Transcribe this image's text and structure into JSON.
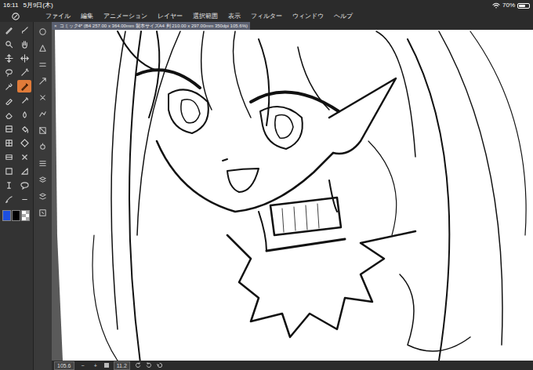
{
  "status_bar": {
    "time": "16:11",
    "date": "5月9日(木)",
    "battery": "70%"
  },
  "menu": [
    "ファイル",
    "編集",
    "アニメーション",
    "レイヤー",
    "選択範囲",
    "表示",
    "フィルター",
    "ウィンドウ",
    "ヘルプ"
  ],
  "document_tab": {
    "close": "×",
    "title": "コミック4* (B4 257.00 x 364.00mm 製本サイズA4 判 210.00 x 297.00mm 350dpi 105.6%)"
  },
  "tools": [
    {
      "selected": false
    },
    {
      "selected": false
    },
    {
      "selected": false
    },
    {
      "selected": false
    },
    {
      "selected": false
    },
    {
      "selected": false
    },
    {
      "selected": false
    },
    {
      "selected": false
    },
    {
      "selected": false
    },
    {
      "selected": true
    },
    {
      "selected": false
    },
    {
      "selected": false
    },
    {
      "selected": false
    },
    {
      "selected": false
    },
    {
      "selected": false
    },
    {
      "selected": false
    },
    {
      "selected": false
    },
    {
      "selected": false
    },
    {
      "selected": false
    },
    {
      "selected": false
    },
    {
      "selected": false
    },
    {
      "selected": false
    },
    {
      "selected": false
    },
    {
      "selected": false
    },
    {
      "selected": false
    },
    {
      "selected": false
    }
  ],
  "sub_tools": [
    {
      "selected": false
    },
    {
      "selected": false
    },
    {
      "selected": false
    },
    {
      "selected": false
    },
    {
      "selected": false
    },
    {
      "selected": false
    },
    {
      "selected": false
    },
    {
      "selected": false
    },
    {
      "selected": false
    },
    {
      "selected": false
    },
    {
      "selected": false
    },
    {
      "selected": false
    }
  ],
  "colors": [
    {
      "kind": "swatch",
      "color": "#1d4fe0"
    },
    {
      "kind": "swatch",
      "color": "#000000"
    },
    {
      "kind": "transparent"
    }
  ],
  "bottom_bar": {
    "zoom": "105.6",
    "minus": "−",
    "plus": "+",
    "rotation": "11.2"
  }
}
